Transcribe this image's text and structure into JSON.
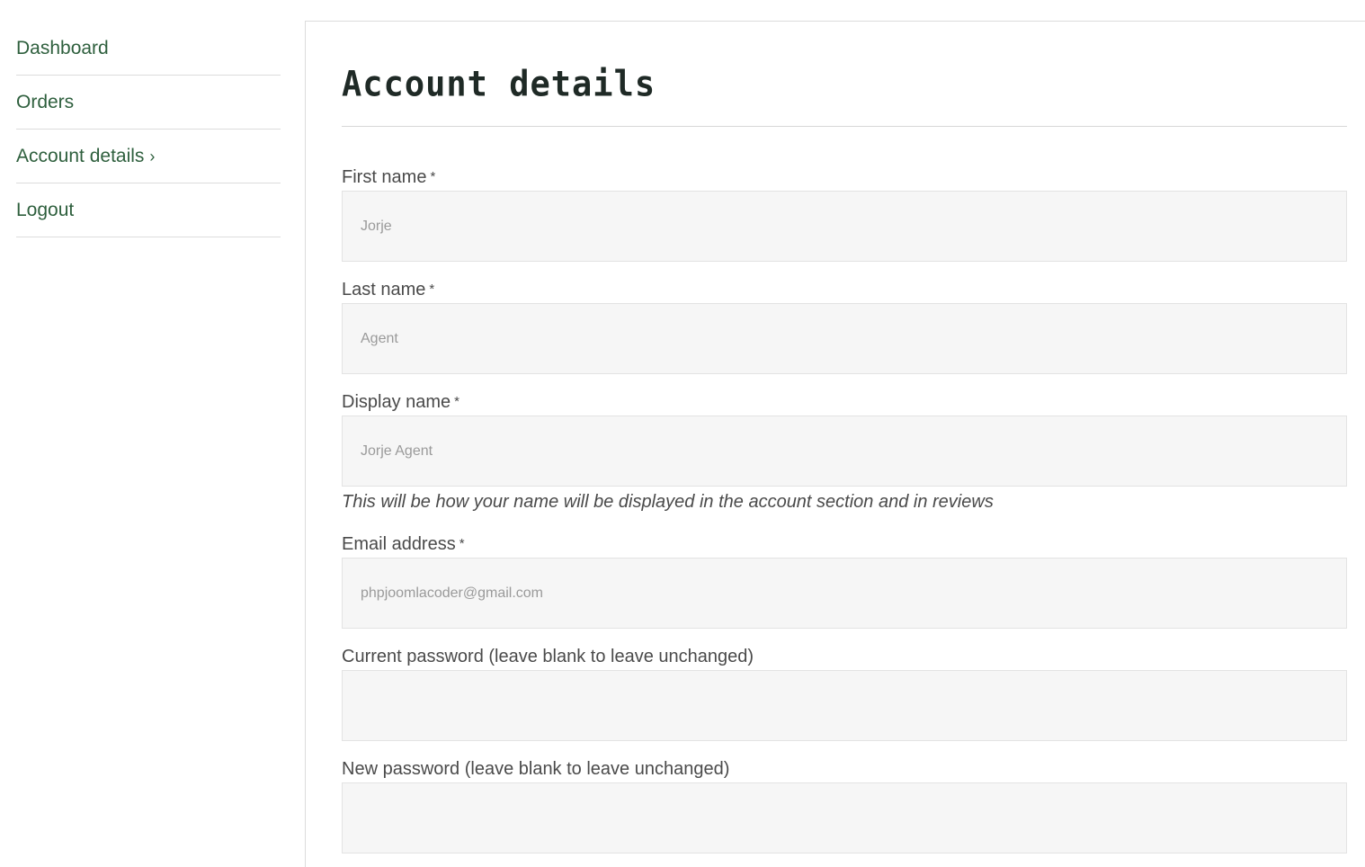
{
  "sidebar": {
    "items": [
      {
        "label": "Dashboard"
      },
      {
        "label": "Orders"
      },
      {
        "label": "Account details",
        "suffix": "›",
        "active": true
      },
      {
        "label": "Logout"
      }
    ]
  },
  "main": {
    "title": "Account details",
    "fields": {
      "first_name": {
        "label": "First name",
        "required_mark": "*",
        "value": "Jorje"
      },
      "last_name": {
        "label": "Last name",
        "required_mark": "*",
        "value": "Agent"
      },
      "display_name": {
        "label": "Display name",
        "required_mark": "*",
        "value": "Jorje Agent",
        "hint": "This will be how your name will be displayed in the account section and in reviews"
      },
      "email": {
        "label": "Email address",
        "required_mark": "*",
        "value": "phpjoomlacoder@gmail.com"
      },
      "current_password": {
        "label": "Current password (leave blank to leave unchanged)",
        "value": ""
      },
      "new_password": {
        "label": "New password (leave blank to leave unchanged)",
        "value": ""
      }
    }
  },
  "colors": {
    "nav_link": "#2e5f3d",
    "title": "#1f2a26",
    "input_bg": "#f6f6f6",
    "border": "#dcdcdc"
  }
}
